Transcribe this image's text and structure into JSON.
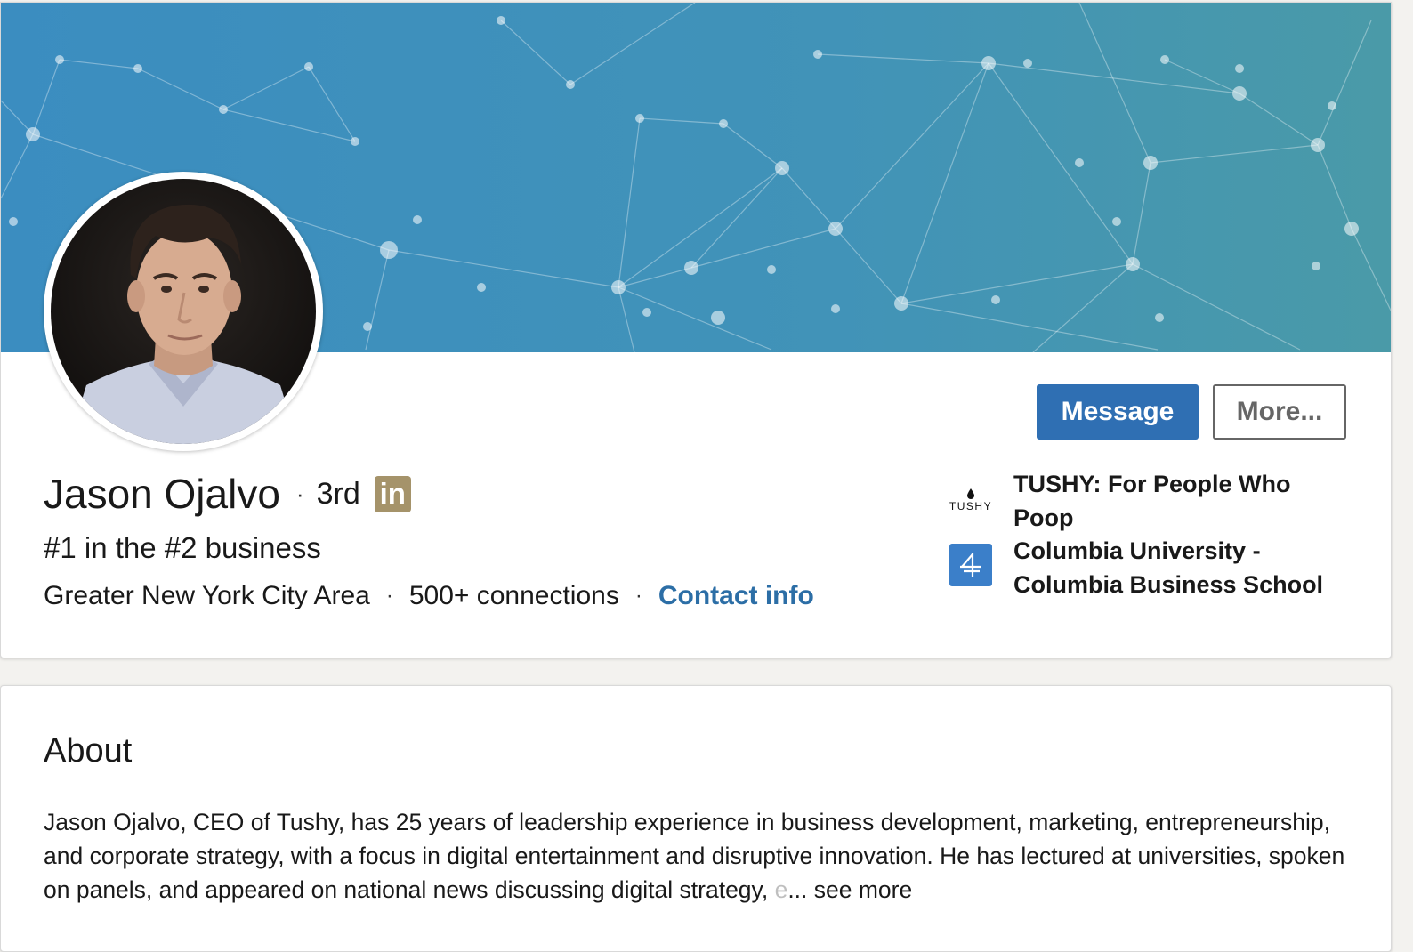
{
  "profile": {
    "name": "Jason Ojalvo",
    "separator": "·",
    "degree": "3rd",
    "premium_badge": "in",
    "headline": "#1 in the #2 business",
    "location": "Greater New York City Area",
    "connections": "500+ connections",
    "contact_info": "Contact info"
  },
  "actions": {
    "message_label": "Message",
    "more_label": "More..."
  },
  "organizations": [
    {
      "logo_text": "TUSHY",
      "name": "TUSHY: For People Who Poop",
      "logo_icon": "tushy-logo-icon"
    },
    {
      "name": "Columbia University - Columbia Business School",
      "logo_icon": "columbia-logo-icon",
      "logo_color": "#3b7fc9"
    }
  ],
  "about": {
    "title": "About",
    "text": "Jason Ojalvo, CEO of Tushy, has 25 years of leadership experience in business development, marketing, entrepreneurship, and corporate strategy, with a focus in digital entertainment and disruptive innovation. He has lectured at universities, spoken on panels, and appeared on national news discussing digital strategy,",
    "faded_text": " e",
    "ellipsis": "...",
    "see_more": " see more"
  },
  "colors": {
    "banner_top": "#3d8fbf",
    "banner_bottom": "#4a9aab",
    "primary": "#2f6fb3",
    "link": "#2c6ea6",
    "premium_gold": "#a5936a"
  }
}
